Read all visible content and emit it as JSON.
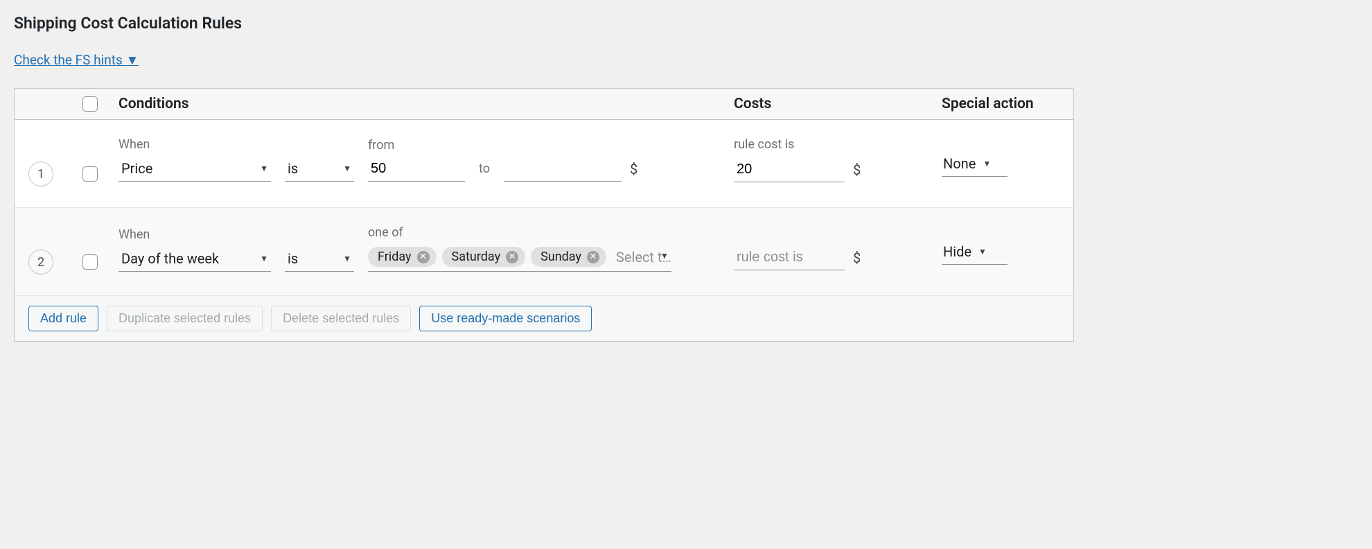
{
  "title": "Shipping Cost Calculation Rules",
  "hints_link": "Check the FS hints ▼",
  "headers": {
    "conditions": "Conditions",
    "costs": "Costs",
    "action": "Special action"
  },
  "labels": {
    "when": "When",
    "from": "from",
    "to": "to",
    "one_of": "one of",
    "rule_cost": "rule cost is",
    "is": "is",
    "currency": "$"
  },
  "rules": [
    {
      "num": "1",
      "condition_selected": "Price",
      "is_selected": "is",
      "from_value": "50",
      "to_value": "",
      "cost_value": "20",
      "action": "None"
    },
    {
      "num": "2",
      "condition_selected": "Day of the week",
      "is_selected": "is",
      "tags": [
        "Friday",
        "Saturday",
        "Sunday"
      ],
      "tags_placeholder": "Select t…",
      "cost_placeholder": "rule cost is",
      "action": "Hide"
    }
  ],
  "buttons": {
    "add": "Add rule",
    "duplicate": "Duplicate selected rules",
    "delete": "Delete selected rules",
    "scenarios": "Use ready-made scenarios"
  }
}
